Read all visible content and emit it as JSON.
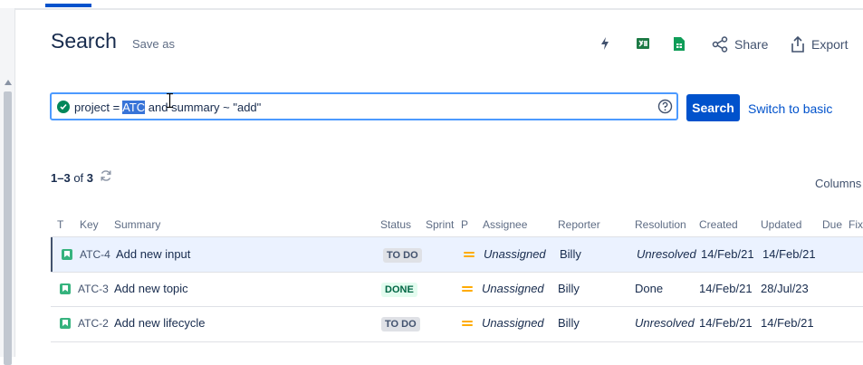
{
  "page": {
    "title": "Search",
    "save_as": "Save as"
  },
  "toolbar": {
    "bolt_icon": "bolt-icon",
    "excel_icon": "excel-icon",
    "sheets_icon": "sheets-icon",
    "share_label": "Share",
    "export_label": "Export"
  },
  "jql": {
    "prefix": "project = ",
    "selected": "ATC",
    "suffix": " and summary ~ \"add\"",
    "search_button": "Search",
    "switch_label": "Switch to basic"
  },
  "results": {
    "range": "1–3",
    "of_label": "of",
    "total": "3",
    "columns_label": "Columns"
  },
  "columns": [
    "T",
    "Key",
    "Summary",
    "Status",
    "Sprint",
    "P",
    "Assignee",
    "Reporter",
    "Resolution",
    "Created",
    "Updated",
    "Due",
    "Fix"
  ],
  "rows": [
    {
      "key": "ATC-4",
      "summary": "Add new input",
      "status": "TO DO",
      "assignee": "Unassigned",
      "reporter": "Billy",
      "resolution": "Unresolved",
      "created": "14/Feb/21",
      "updated": "14/Feb/21"
    },
    {
      "key": "ATC-3",
      "summary": "Add new topic",
      "status": "DONE",
      "assignee": "Unassigned",
      "reporter": "Billy",
      "resolution": "Done",
      "created": "14/Feb/21",
      "updated": "28/Jul/23"
    },
    {
      "key": "ATC-2",
      "summary": "Add new lifecycle",
      "status": "TO DO",
      "assignee": "Unassigned",
      "reporter": "Billy",
      "resolution": "Unresolved",
      "created": "14/Feb/21",
      "updated": "14/Feb/21"
    }
  ],
  "colors": {
    "accent": "#0052cc",
    "valid": "#00875a",
    "story": "#36b37e",
    "priority_medium": "#ffab00"
  }
}
